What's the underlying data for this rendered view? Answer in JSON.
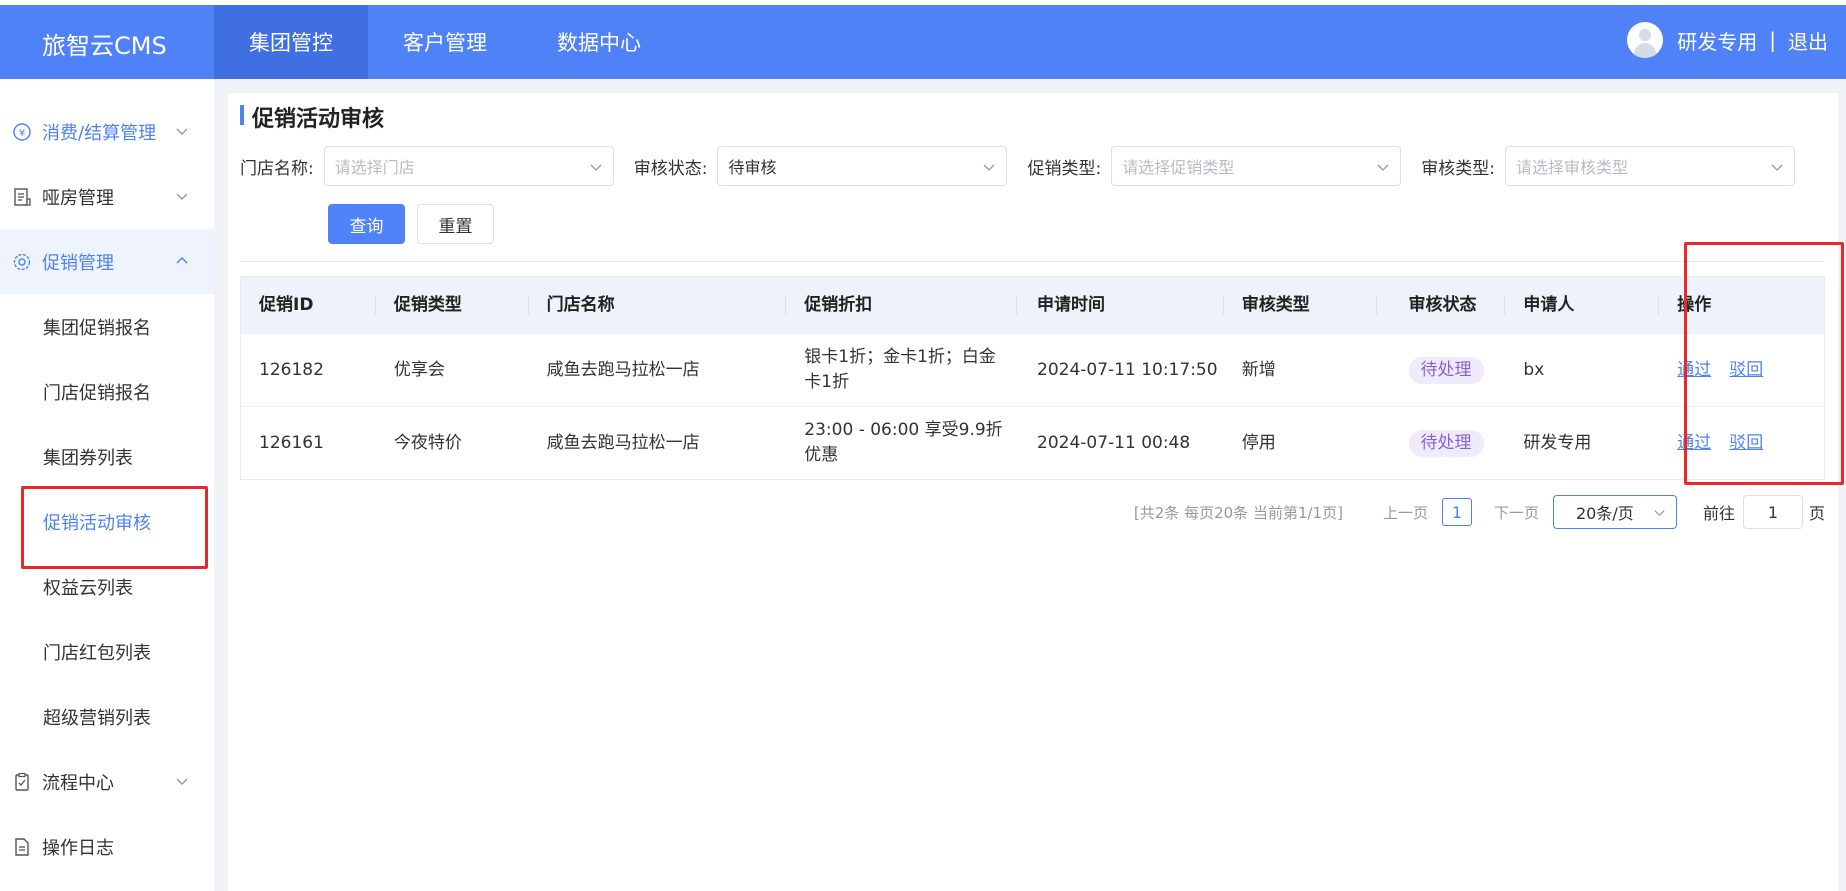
{
  "app": {
    "brand": "旅智云CMS",
    "top_nav": [
      {
        "label": "集团管控",
        "active": true
      },
      {
        "label": "客户管理",
        "active": false
      },
      {
        "label": "数据中心",
        "active": false
      }
    ],
    "user_name": "研发专用",
    "separator": "|",
    "logout": "退出"
  },
  "sidebar": {
    "items": [
      {
        "label": "消费/结算管理",
        "icon": "yen-circle-icon"
      },
      {
        "label": "哑房管理",
        "icon": "document-list-icon"
      },
      {
        "label": "促销管理",
        "icon": "gear-badge-icon"
      },
      {
        "label": "流程中心",
        "icon": "clipboard-icon"
      },
      {
        "label": "操作日志",
        "icon": "log-file-icon"
      }
    ],
    "sub_items": [
      "集团促销报名",
      "门店促销报名",
      "集团券列表",
      "促销活动审核",
      "权益云列表",
      "门店红包列表",
      "超级营销列表"
    ],
    "active_sub": "促销活动审核"
  },
  "page": {
    "title": "促销活动审核",
    "filters": [
      {
        "label": "门店名称:",
        "value": "",
        "placeholder": "请选择门店"
      },
      {
        "label": "审核状态:",
        "value": "待审核",
        "placeholder": ""
      },
      {
        "label": "促销类型:",
        "value": "",
        "placeholder": "请选择促销类型"
      },
      {
        "label": "审核类型:",
        "value": "",
        "placeholder": "请选择审核类型"
      }
    ],
    "query_button": "查询",
    "reset_button": "重置"
  },
  "table": {
    "columns": [
      "促销ID",
      "促销类型",
      "门店名称",
      "促销折扣",
      "申请时间",
      "审核类型",
      "审核状态",
      "申请人",
      "操作"
    ],
    "rows": [
      {
        "id": "126182",
        "type": "优享会",
        "store": "咸鱼去跑马拉松一店",
        "discount_line1": "银卡1折；金卡1折；白金",
        "discount_line2": "卡1折",
        "time": "2024-07-11 10:17:50",
        "audit_type": "新增",
        "status": "待处理",
        "applicant": "bx",
        "approve": "通过",
        "reject": "驳回"
      },
      {
        "id": "126161",
        "type": "今夜特价",
        "store": "咸鱼去跑马拉松一店",
        "discount_line1": "23:00 - 06:00 享受9.9折",
        "discount_line2": "优惠",
        "time": "2024-07-11 00:48",
        "audit_type": "停用",
        "status": "待处理",
        "applicant": "研发专用",
        "approve": "通过",
        "reject": "驳回"
      }
    ]
  },
  "pagination": {
    "summary": "[共2条 每页20条 当前第1/1页]",
    "prev": "上一页",
    "current_page": "1",
    "next": "下一页",
    "page_size": "20条/页",
    "goto_label": "前往",
    "goto_value": "1",
    "page_unit": "页"
  },
  "colors": {
    "primary": "#4f81f7",
    "highlight_box": "#e8282b",
    "status_badge_bg": "#f0eafd",
    "status_badge_text": "#8a63d2"
  }
}
